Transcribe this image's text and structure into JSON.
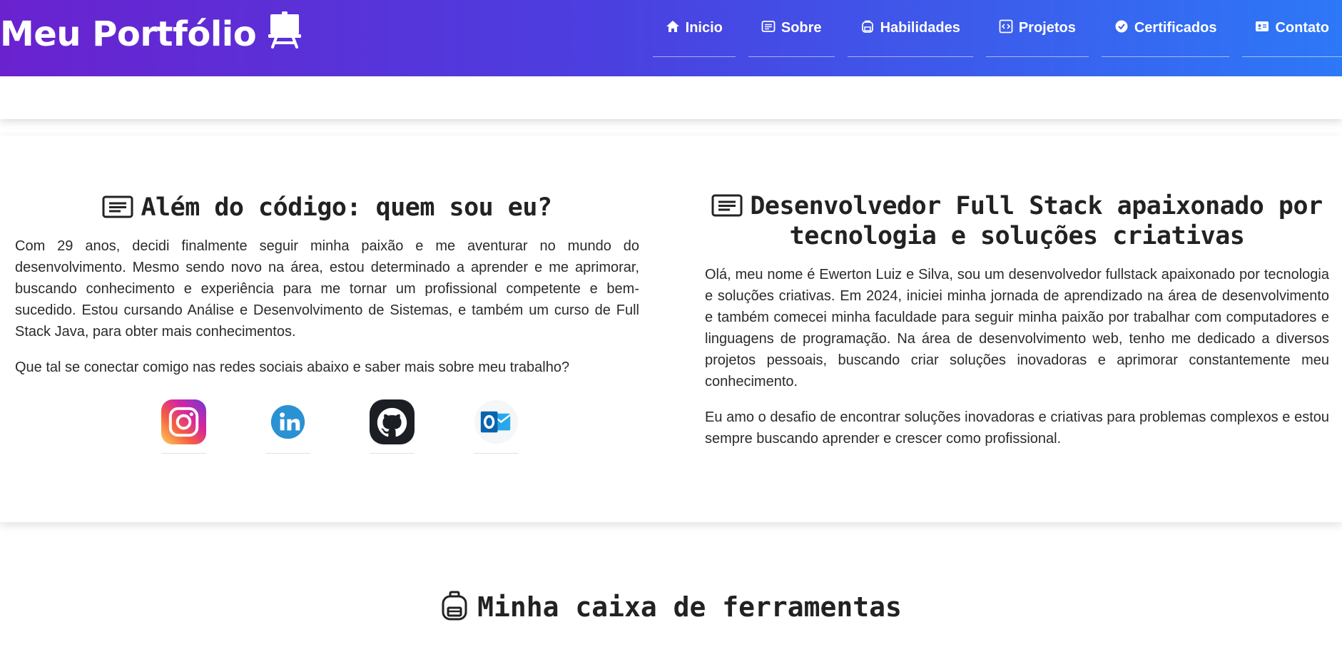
{
  "header": {
    "brand": "Meu Portfólio",
    "nav": [
      {
        "label": "Inicio",
        "icon": "home-icon"
      },
      {
        "label": "Sobre",
        "icon": "card-icon"
      },
      {
        "label": "Habilidades",
        "icon": "backpack-icon"
      },
      {
        "label": "Projetos",
        "icon": "code-icon"
      },
      {
        "label": "Certificados",
        "icon": "verified-icon"
      },
      {
        "label": "Contato",
        "icon": "contact-card-icon"
      }
    ]
  },
  "about_left": {
    "title": "Além do código: quem sou eu?",
    "paragraph1": "Com 29 anos, decidi finalmente seguir minha paixão e me aventurar no mundo do desenvolvimento. Mesmo sendo novo na área, estou determinado a aprender e me aprimorar, buscando conhecimento e experiência para me tornar um profissional competente e bem-sucedido. Estou cursando Análise e Desenvolvimento de Sistemas, e também um curso de Full Stack Java, para obter mais conhecimentos.",
    "paragraph2": "Que tal se conectar comigo nas redes sociais abaixo e saber mais sobre meu trabalho?",
    "socials": [
      {
        "name": "instagram-icon"
      },
      {
        "name": "linkedin-icon"
      },
      {
        "name": "github-icon"
      },
      {
        "name": "outlook-icon"
      }
    ]
  },
  "about_right": {
    "title": "Desenvolvedor Full Stack apaixonado por tecnologia e soluções criativas",
    "paragraph1": "Olá, meu nome é Ewerton Luiz e Silva, sou um desenvolvedor fullstack apaixonado por tecnologia e soluções criativas. Em 2024, iniciei minha jornada de aprendizado na área de desenvolvimento e também comecei minha faculdade para seguir minha paixão por trabalhar com computadores e linguagens de programação. Na área de desenvolvimento web, tenho me dedicado a diversos projetos pessoais, buscando criar soluções inovadoras e aprimorar constantemente meu conhecimento.",
    "paragraph2": "Eu amo o desafio de encontrar soluções inovadoras e criativas para problemas complexos e estou sempre buscando aprender e crescer como profissional."
  },
  "tools": {
    "title": "Minha caixa de ferramentas"
  },
  "colors": {
    "header_gradient_start": "#6a22cf",
    "header_gradient_end": "#2d78f7",
    "text": "#2b2b2b"
  }
}
